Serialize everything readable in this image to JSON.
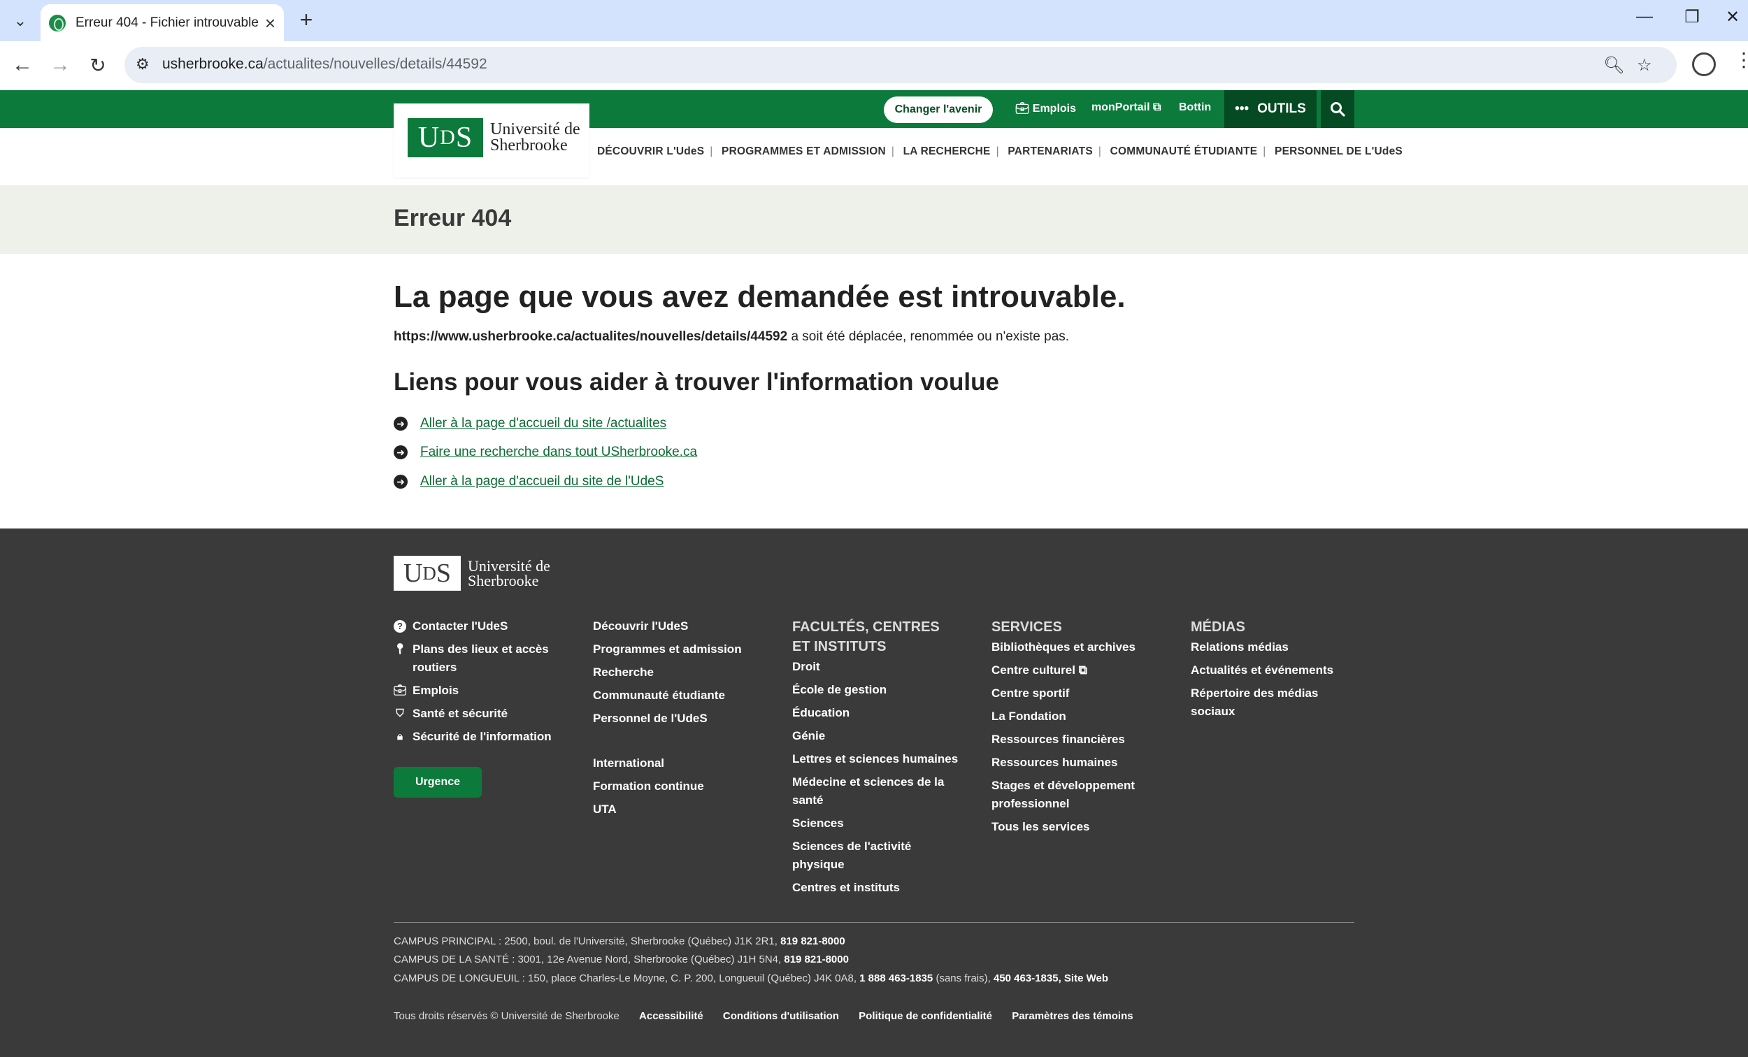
{
  "browser": {
    "tab_title": "Erreur 404 - Fichier introuvable",
    "url_host": "usherbrooke.ca",
    "url_path": "/actualites/nouvelles/details/44592"
  },
  "site": {
    "logo_text_line1": "Université de",
    "logo_text_line2": "Sherbrooke",
    "logo_mark": "UdS",
    "change_future_button": "Changer l'avenir",
    "top_links": [
      "Emplois",
      "monPortail",
      "Bottin"
    ],
    "tools_label": "OUTILS",
    "main_nav": [
      "DÉCOUVRIR L'UdeS",
      "PROGRAMMES ET ADMISSION",
      "LA RECHERCHE",
      "PARTENARIATS",
      "COMMUNAUTÉ ÉTUDIANTE",
      "PERSONNEL DE L'UdeS"
    ]
  },
  "page": {
    "title": "Erreur 404",
    "heading": "La page que vous avez demandée est introuvable.",
    "missing_url": "https://www.usherbrooke.ca/actualites/nouvelles/details/44592",
    "missing_text": " a soit été déplacée, renommée ou n'existe pas.",
    "links_heading": "Liens pour vous aider à trouver l'information voulue",
    "help_links": [
      "Aller à la page d'accueil du site /actualites",
      "Faire une recherche dans tout USherbrooke.ca",
      "Aller à la page d'accueil du site de l'UdeS"
    ]
  },
  "footer": {
    "contact": [
      "Contacter l'UdeS",
      "Plans des lieux et accès routiers",
      "Emplois",
      "Santé et sécurité",
      "Sécurité de l'information"
    ],
    "urgence": "Urgence",
    "col2_a": [
      "Découvrir l'UdeS",
      "Programmes et admission",
      "Recherche",
      "Communauté étudiante",
      "Personnel de l'UdeS"
    ],
    "col2_b": [
      "International",
      "Formation continue",
      "UTA"
    ],
    "faculties_heading": "FACULTÉS, CENTRES ET INSTITUTS",
    "faculties": [
      "Droit",
      "École de gestion",
      "Éducation",
      "Génie",
      "Lettres et sciences humaines",
      "Médecine et sciences de la santé",
      "Sciences",
      "Sciences de l'activité physique",
      "Centres et instituts"
    ],
    "services_heading": "SERVICES",
    "services": [
      "Bibliothèques et archives",
      "Centre culturel",
      "Centre sportif",
      "La Fondation",
      "Ressources financières",
      "Ressources humaines",
      "Stages et développement professionnel",
      "Tous les services"
    ],
    "medias_heading": "MÉDIAS",
    "medias": [
      "Relations médias",
      "Actualités et événements",
      "Répertoire des médias sociaux"
    ],
    "address_1_text": "CAMPUS PRINCIPAL : 2500, boul. de l'Université, Sherbrooke (Québec) J1K 2R1,",
    "address_1_phone": "819 821-8000",
    "address_2_text": "CAMPUS DE LA SANTÉ : 3001, 12e Avenue Nord, Sherbrooke (Québec) J1H 5N4,",
    "address_2_phone": "819 821-8000",
    "address_3_text": "CAMPUS DE LONGUEUIL : 150, place Charles-Le Moyne, C. P. 200, Longueuil (Québec) J4K 0A8,",
    "address_3_phone1": "1 888 463-1835",
    "address_3_mid": "(sans frais),",
    "address_3_phone2": "450 463-1835,",
    "address_3_site": "Site Web",
    "copyright": "Tous droits réservés © Université de Sherbrooke",
    "legal_links": [
      "Accessibilité",
      "Conditions d'utilisation",
      "Politique de confidentialité",
      "Paramètres des témoins"
    ]
  },
  "colors": {
    "brand_green": "#0b7a3b",
    "dark_green": "#054a22",
    "footer_bg": "#3a3a3a"
  }
}
